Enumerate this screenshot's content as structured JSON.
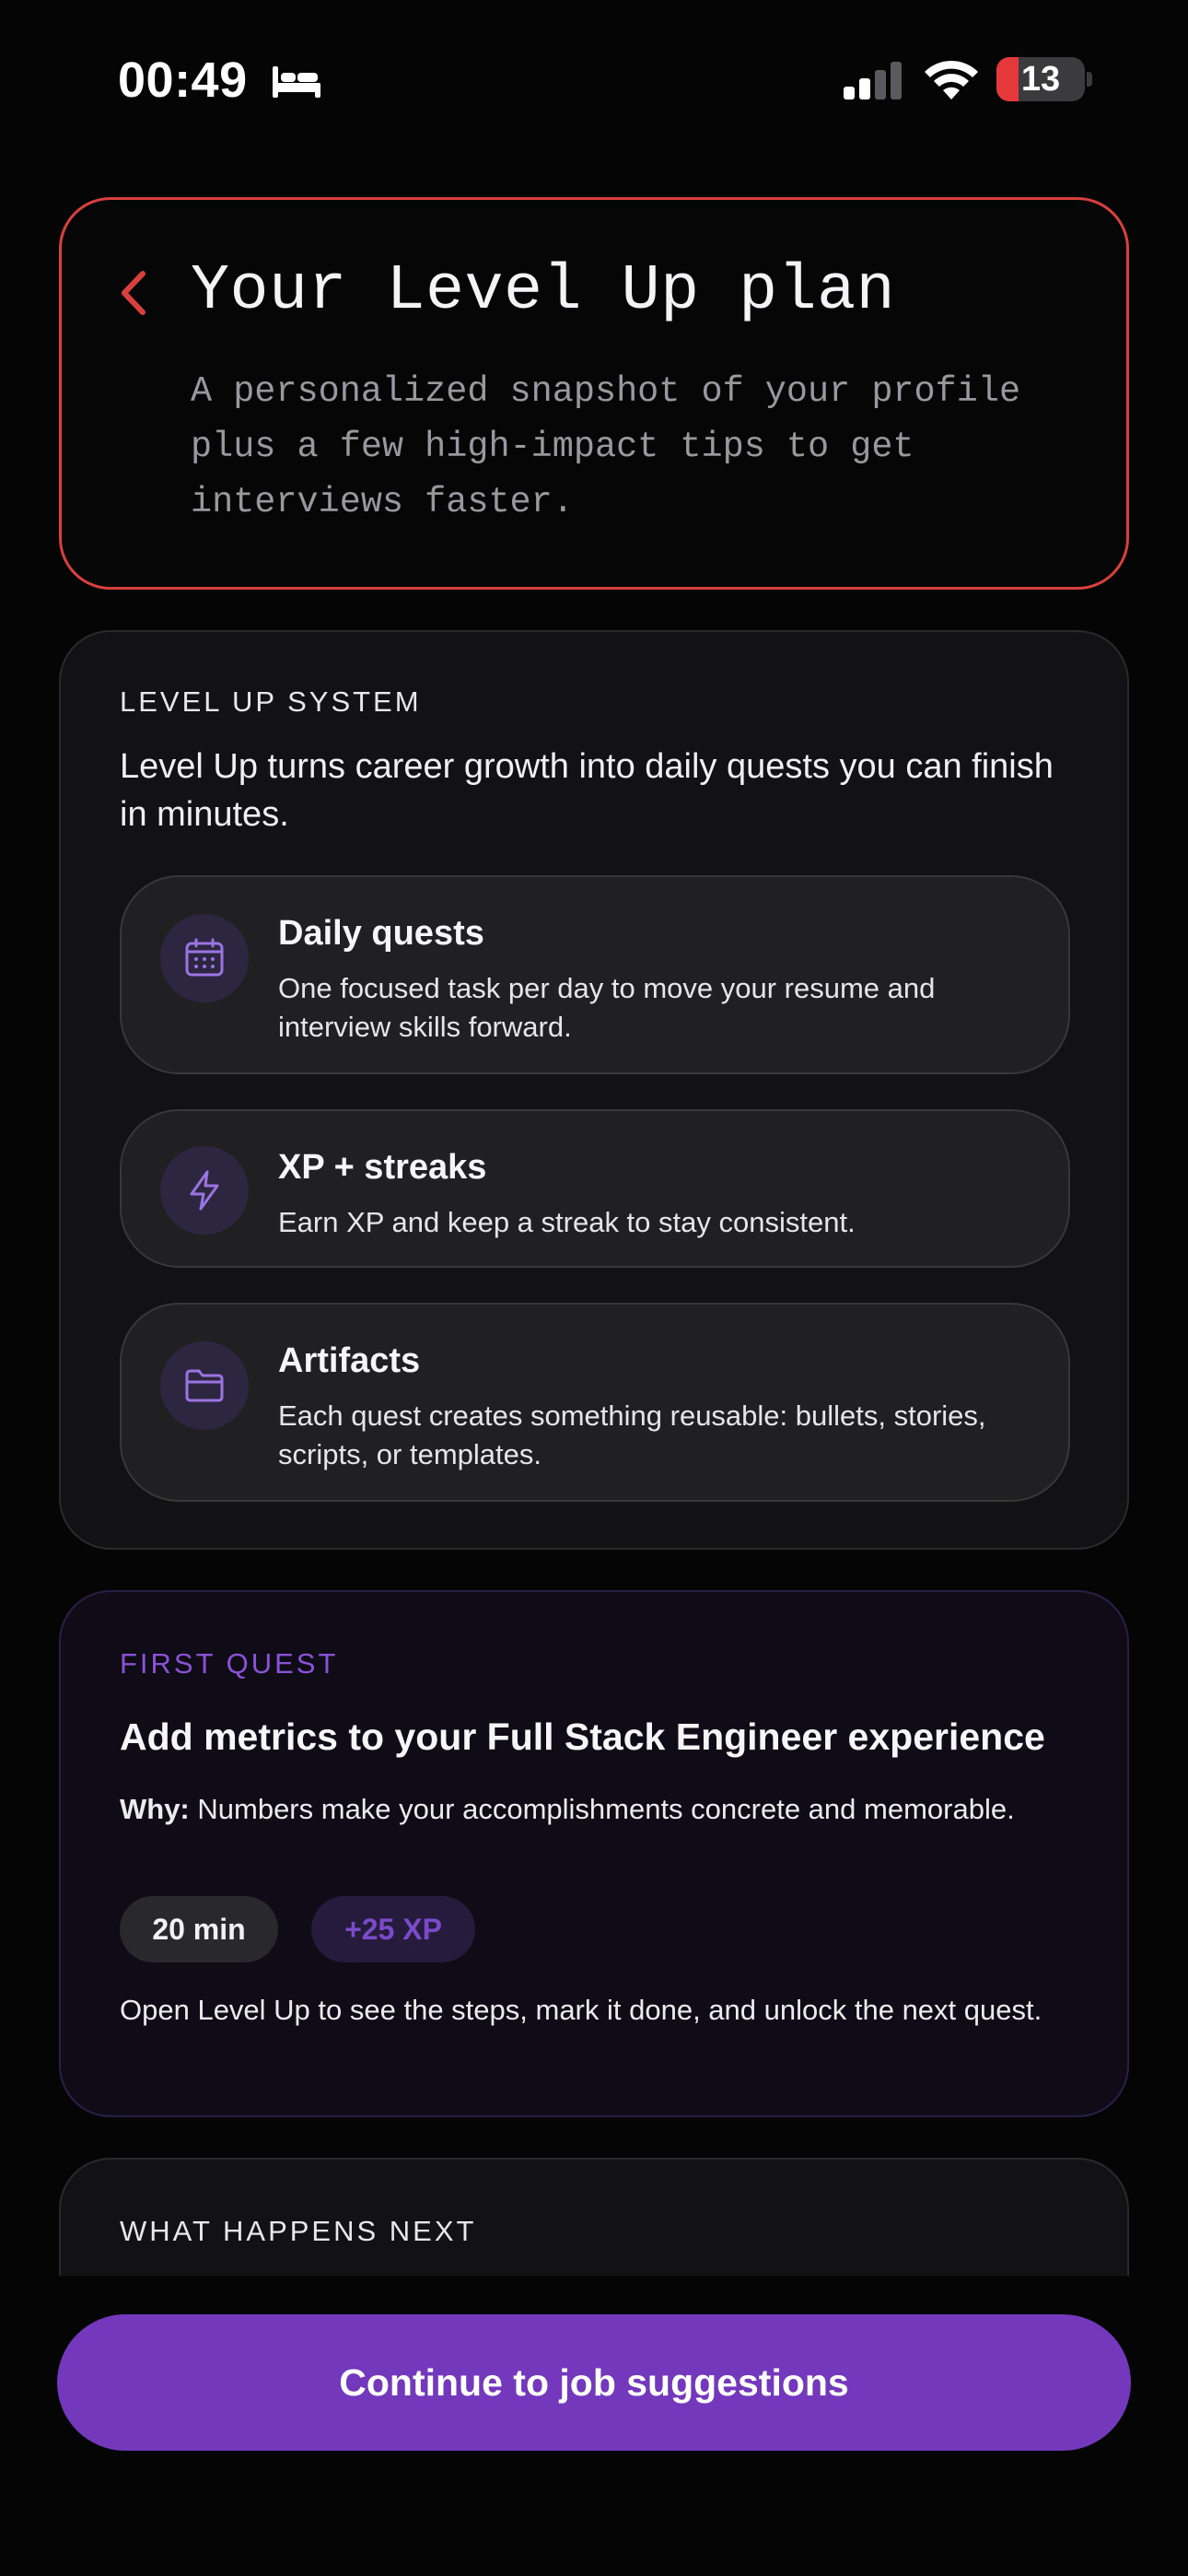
{
  "status_bar": {
    "time": "00:49",
    "battery_level": "13",
    "battery_fraction": 0.13,
    "icons": [
      "bed-icon",
      "cellular-signal-icon",
      "wifi-icon",
      "battery-icon"
    ]
  },
  "header": {
    "title": "Your Level Up plan",
    "subtitle": "A personalized snapshot of your profile plus a few high-impact tips to get interviews faster.",
    "back_icon": "chevron-left-icon",
    "accent_color": "#d7403d"
  },
  "system": {
    "label": "LEVEL UP SYSTEM",
    "description": "Level Up turns career growth into daily quests you can finish in minutes.",
    "features": [
      {
        "icon": "calendar-icon",
        "title": "Daily quests",
        "description": "One focused task per day to move your resume and interview skills forward."
      },
      {
        "icon": "lightning-icon",
        "title": "XP + streaks",
        "description": "Earn XP and keep a streak to stay consistent."
      },
      {
        "icon": "folder-icon",
        "title": "Artifacts",
        "description": "Each quest creates something reusable: bullets, stories, scripts, or templates."
      }
    ]
  },
  "quest": {
    "label": "FIRST QUEST",
    "title": "Add metrics to your Full Stack Engineer experience",
    "why_label": "Why:",
    "why_text": " Numbers make your accomplishments concrete and memorable.",
    "duration": "20 min",
    "xp": "+25 XP",
    "note": "Open Level Up to see the steps, mark it done, and unlock the next quest.",
    "accent_color": "#8a52d6"
  },
  "next": {
    "label": "WHAT HAPPENS NEXT"
  },
  "cta": {
    "label": "Continue to job suggestions",
    "color": "#7338bb"
  }
}
